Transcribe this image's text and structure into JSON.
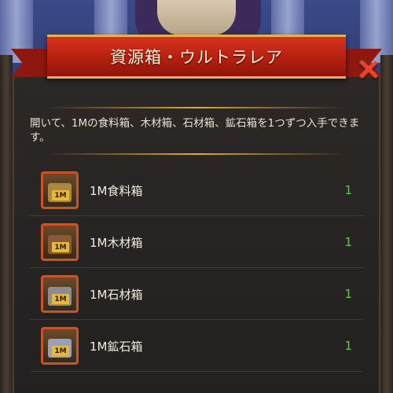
{
  "title": "資源箱・ウルトラレア",
  "description": "開いて、1Mの食料箱、木材箱、石材箱、鉱石箱を1つずつ入手できます。",
  "items": [
    {
      "name": "1M食料箱",
      "qty": "1",
      "icon": "food-chest-icon",
      "tag": "1M",
      "color": "#a88a3a"
    },
    {
      "name": "1M木材箱",
      "qty": "1",
      "icon": "wood-chest-icon",
      "tag": "1M",
      "color": "#8a5a36"
    },
    {
      "name": "1M石材箱",
      "qty": "1",
      "icon": "stone-chest-icon",
      "tag": "1M",
      "color": "#8c8c94"
    },
    {
      "name": "1M鉱石箱",
      "qty": "1",
      "icon": "ore-chest-icon",
      "tag": "1M",
      "color": "#9aa0b8"
    }
  ],
  "colors": {
    "accent_gold": "#e9b04b",
    "ribbon_red": "#c42a18",
    "qty_green": "#55d23a"
  }
}
